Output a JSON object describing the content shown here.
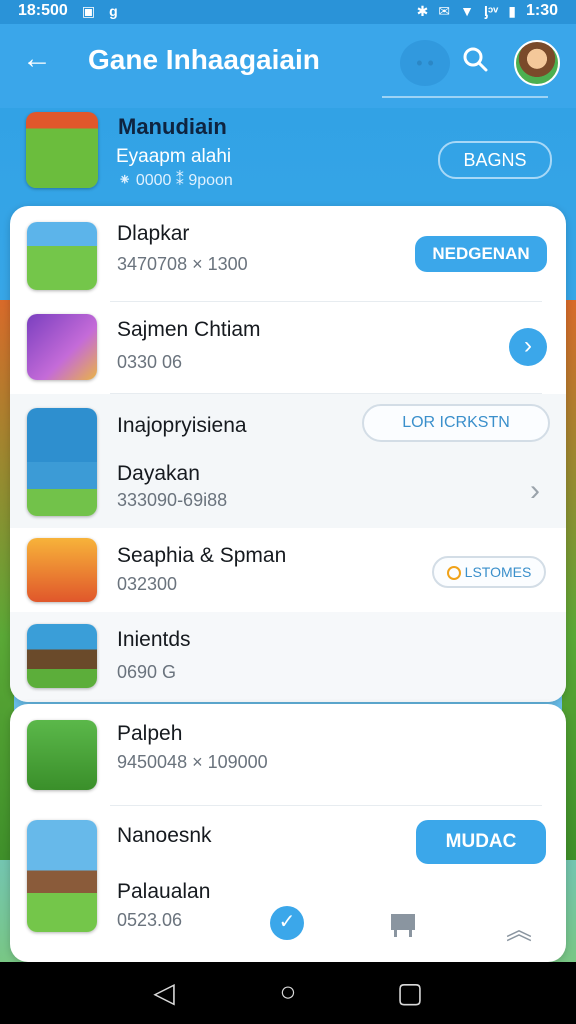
{
  "status": {
    "time_left": "18:500",
    "time_right": "1:30",
    "net_label": "ᶅᵓᵛ"
  },
  "header": {
    "title": "Gane Inhaagaiain",
    "back_icon": "arrow-left-icon",
    "search_icon": "search-icon"
  },
  "featured": {
    "title": "Manudiain",
    "subtitle": "Eyaapm alahi",
    "meta": "⁕ 0000   ⁑ 9poon",
    "button": "BAGNS"
  },
  "list": [
    {
      "name": "Dlapkar",
      "meta": "3470708  × 1300",
      "action": "NEDGENAN",
      "action_type": "filled"
    },
    {
      "name": "Sajmen Chtiam",
      "meta": "0330 06",
      "action": "›",
      "action_type": "circle"
    },
    {
      "name": "Inajopryisiena",
      "meta": "",
      "action": "LOR ICRKSTN",
      "action_type": "outline"
    },
    {
      "name": "Dayakan",
      "meta": "333090-69i88",
      "action": "›",
      "action_type": "chevron"
    },
    {
      "name": "Seaphia & Spman",
      "meta": "032300",
      "action": "LSTOMES",
      "action_type": "outline-dot"
    },
    {
      "name": "Inientds",
      "meta": "0690 G",
      "action": "",
      "action_type": "none"
    }
  ],
  "list2": [
    {
      "name": "Palpeh",
      "meta": "9450048  × 109000",
      "action": "",
      "action_type": "none"
    },
    {
      "name": "Nanoesnk",
      "meta": "",
      "action": "MUDAC",
      "action_type": "filled"
    },
    {
      "name": "Palaualan",
      "meta": "0523.06",
      "action": "",
      "action_type": "none"
    }
  ],
  "colors": {
    "primary": "#3ba7ea",
    "header": "#3aa6ea"
  }
}
